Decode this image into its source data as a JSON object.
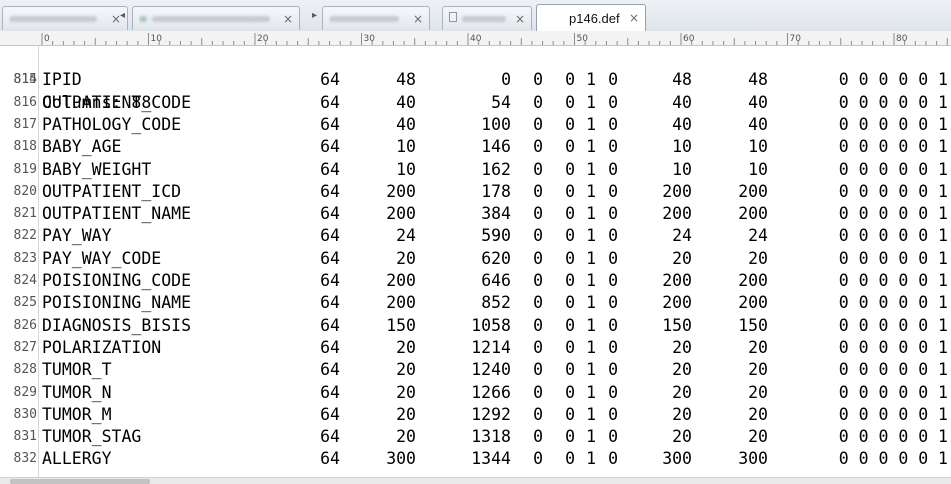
{
  "tabs": [
    {
      "label": "",
      "close": "×",
      "active": false,
      "icon": "blurred-tab-title"
    },
    {
      "label": "",
      "close": "×",
      "active": false,
      "icon": "green-file-icon"
    },
    {
      "label": "",
      "close": "×",
      "active": false,
      "icon": "blurred-tab-title"
    },
    {
      "label": "",
      "close": "×",
      "active": false,
      "icon": "file-icon"
    },
    {
      "label": "p146.def",
      "close": "×",
      "active": true,
      "icon": "none"
    }
  ],
  "ruler": {
    "labels": [
      "0",
      "10",
      "20",
      "30",
      "40",
      "50",
      "60",
      "70",
      "80"
    ]
  },
  "editor": {
    "header_line": {
      "number": "814",
      "text": "Columns: 88"
    },
    "rows": [
      {
        "n": "815",
        "c": [
          "IPID",
          "64",
          "48",
          "0",
          "0",
          "0",
          "1",
          "0",
          "48",
          "48",
          "0 0 0 0 0 1"
        ]
      },
      {
        "n": "816",
        "c": [
          "OUTPATIENT_CODE",
          "64",
          "40",
          "54",
          "0",
          "0",
          "1",
          "0",
          "40",
          "40",
          "0 0 0 0 0 1"
        ]
      },
      {
        "n": "817",
        "c": [
          "PATHOLOGY_CODE",
          "64",
          "40",
          "100",
          "0",
          "0",
          "1",
          "0",
          "40",
          "40",
          "0 0 0 0 0 1"
        ]
      },
      {
        "n": "818",
        "c": [
          "BABY_AGE",
          "64",
          "10",
          "146",
          "0",
          "0",
          "1",
          "0",
          "10",
          "10",
          "0 0 0 0 0 1"
        ]
      },
      {
        "n": "819",
        "c": [
          "BABY_WEIGHT",
          "64",
          "10",
          "162",
          "0",
          "0",
          "1",
          "0",
          "10",
          "10",
          "0 0 0 0 0 1"
        ]
      },
      {
        "n": "820",
        "c": [
          "OUTPATIENT_ICD",
          "64",
          "200",
          "178",
          "0",
          "0",
          "1",
          "0",
          "200",
          "200",
          "0 0 0 0 0 1"
        ]
      },
      {
        "n": "821",
        "c": [
          "OUTPATIENT_NAME",
          "64",
          "200",
          "384",
          "0",
          "0",
          "1",
          "0",
          "200",
          "200",
          "0 0 0 0 0 1"
        ]
      },
      {
        "n": "822",
        "c": [
          "PAY_WAY",
          "64",
          "24",
          "590",
          "0",
          "0",
          "1",
          "0",
          "24",
          "24",
          "0 0 0 0 0 1"
        ]
      },
      {
        "n": "823",
        "c": [
          "PAY_WAY_CODE",
          "64",
          "20",
          "620",
          "0",
          "0",
          "1",
          "0",
          "20",
          "20",
          "0 0 0 0 0 1"
        ]
      },
      {
        "n": "824",
        "c": [
          "POISIONING_CODE",
          "64",
          "200",
          "646",
          "0",
          "0",
          "1",
          "0",
          "200",
          "200",
          "0 0 0 0 0 1"
        ]
      },
      {
        "n": "825",
        "c": [
          "POISIONING_NAME",
          "64",
          "200",
          "852",
          "0",
          "0",
          "1",
          "0",
          "200",
          "200",
          "0 0 0 0 0 1"
        ]
      },
      {
        "n": "826",
        "c": [
          "DIAGNOSIS_BISIS",
          "64",
          "150",
          "1058",
          "0",
          "0",
          "1",
          "0",
          "150",
          "150",
          "0 0 0 0 0 1"
        ]
      },
      {
        "n": "827",
        "c": [
          "POLARIZATION",
          "64",
          "20",
          "1214",
          "0",
          "0",
          "1",
          "0",
          "20",
          "20",
          "0 0 0 0 0 1"
        ]
      },
      {
        "n": "828",
        "c": [
          "TUMOR_T",
          "64",
          "20",
          "1240",
          "0",
          "0",
          "1",
          "0",
          "20",
          "20",
          "0 0 0 0 0 1"
        ]
      },
      {
        "n": "829",
        "c": [
          "TUMOR_N",
          "64",
          "20",
          "1266",
          "0",
          "0",
          "1",
          "0",
          "20",
          "20",
          "0 0 0 0 0 1"
        ]
      },
      {
        "n": "830",
        "c": [
          "TUMOR_M",
          "64",
          "20",
          "1292",
          "0",
          "0",
          "1",
          "0",
          "20",
          "20",
          "0 0 0 0 0 1"
        ]
      },
      {
        "n": "831",
        "c": [
          "TUMOR_STAG",
          "64",
          "20",
          "1318",
          "0",
          "0",
          "1",
          "0",
          "20",
          "20",
          "0 0 0 0 0 1"
        ]
      },
      {
        "n": "832",
        "c": [
          "ALLERGY",
          "64",
          "300",
          "1344",
          "0",
          "0",
          "1",
          "0",
          "300",
          "300",
          "0 0 0 0 0 1"
        ]
      }
    ]
  },
  "colors": {
    "text": "#000000",
    "line_number": "#555555",
    "tab_bar": "#dfe4ea"
  }
}
